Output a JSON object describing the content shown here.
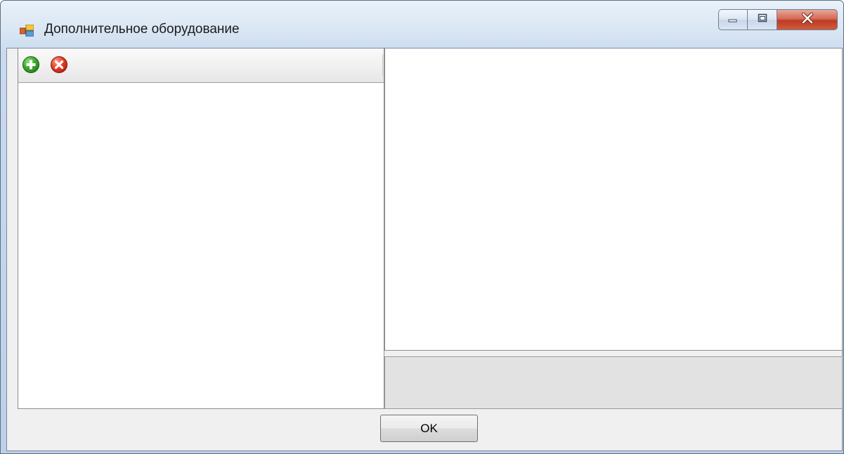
{
  "window": {
    "title": "Дополнительное оборудование",
    "icon": "app-form-icon"
  },
  "caption_buttons": {
    "minimize_icon": "minimize-icon",
    "maximize_icon": "maximize-icon",
    "close_icon": "close-icon"
  },
  "toolbar": {
    "add_icon": "add-circle-icon",
    "delete_icon": "delete-circle-icon"
  },
  "buttons": {
    "ok_label": "OK"
  },
  "colors": {
    "add": "#3aa82a",
    "delete": "#e53e26",
    "close_button": "#c94a30"
  }
}
